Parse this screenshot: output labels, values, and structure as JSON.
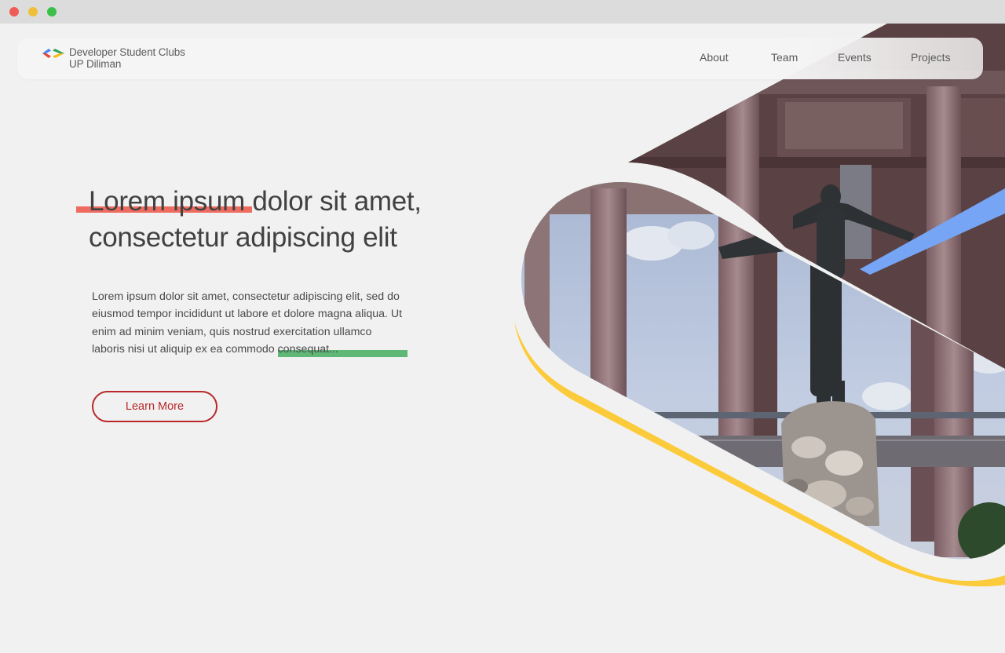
{
  "brand": {
    "line1": "Developer Student Clubs",
    "line2": "UP Diliman"
  },
  "nav": {
    "about": "About",
    "team": "Team",
    "events": "Events",
    "projects": "Projects"
  },
  "hero": {
    "headline_line1": "Lorem ipsum dolor sit amet,",
    "headline_line2": "consectetur adipiscing elit",
    "body": "Lorem ipsum dolor sit amet, consectetur adipiscing elit, sed do eiusmod tempor incididunt ut labore et dolore magna aliqua. Ut enim ad minim veniam, quis nostrud exercitation ullamco laboris nisi ut aliquip ex ea commodo consequat...",
    "cta_label": "Learn More"
  },
  "colors": {
    "accent_red": "#ee6b5f",
    "accent_green": "#5fb876",
    "accent_yellow": "#fccb3b",
    "accent_blue": "#76a5f5",
    "button_red": "#b8282a",
    "logo_blue": "#4a86ec",
    "logo_red": "#e5483c",
    "logo_yellow": "#f5b918",
    "logo_green": "#2ea45a"
  }
}
